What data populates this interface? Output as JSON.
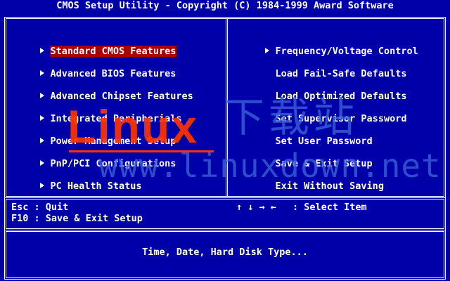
{
  "window": {
    "title": "CMOS Setup Utility - Copyright (C) 1984-1999 Award Software"
  },
  "colors": {
    "background": "#0000a8",
    "text": "#ffffff",
    "highlight": "#a80000",
    "watermark_red": "#ff3300",
    "watermark_blue": "#3a5fd8"
  },
  "menu": {
    "left": [
      {
        "label": "Standard CMOS Features",
        "icon": "triangle-right-icon",
        "selected": true
      },
      {
        "label": "Advanced BIOS Features",
        "icon": "triangle-right-icon",
        "selected": false
      },
      {
        "label": "Advanced Chipset Features",
        "icon": "triangle-right-icon",
        "selected": false
      },
      {
        "label": "Integrated Peripherials",
        "icon": "triangle-right-icon",
        "selected": false
      },
      {
        "label": "Power Management Setup",
        "icon": "triangle-right-icon",
        "selected": false
      },
      {
        "label": "PnP/PCI Configurations",
        "icon": "triangle-right-icon",
        "selected": false
      },
      {
        "label": "PC Health Status",
        "icon": "triangle-right-icon",
        "selected": false
      }
    ],
    "right": [
      {
        "label": "Frequency/Voltage Control",
        "icon": "triangle-right-icon"
      },
      {
        "label": "Load Fail-Safe Defaults"
      },
      {
        "label": "Load Optimized Defaults"
      },
      {
        "label": "Set Supervisor Password"
      },
      {
        "label": "Set User Password"
      },
      {
        "label": "Save & Exit Setup"
      },
      {
        "label": "Exit Without Saving"
      }
    ]
  },
  "help": {
    "esc": "Esc : Quit",
    "f10": "F10 : Save & Exit Setup",
    "arrows": "↑ ↓ → ←",
    "select": ": Select Item"
  },
  "status": {
    "description": "Time, Date, Hard Disk Type..."
  },
  "watermark": {
    "brand": "Linux",
    "chinese": "下载站",
    "url": "www.linuxdown.net"
  }
}
